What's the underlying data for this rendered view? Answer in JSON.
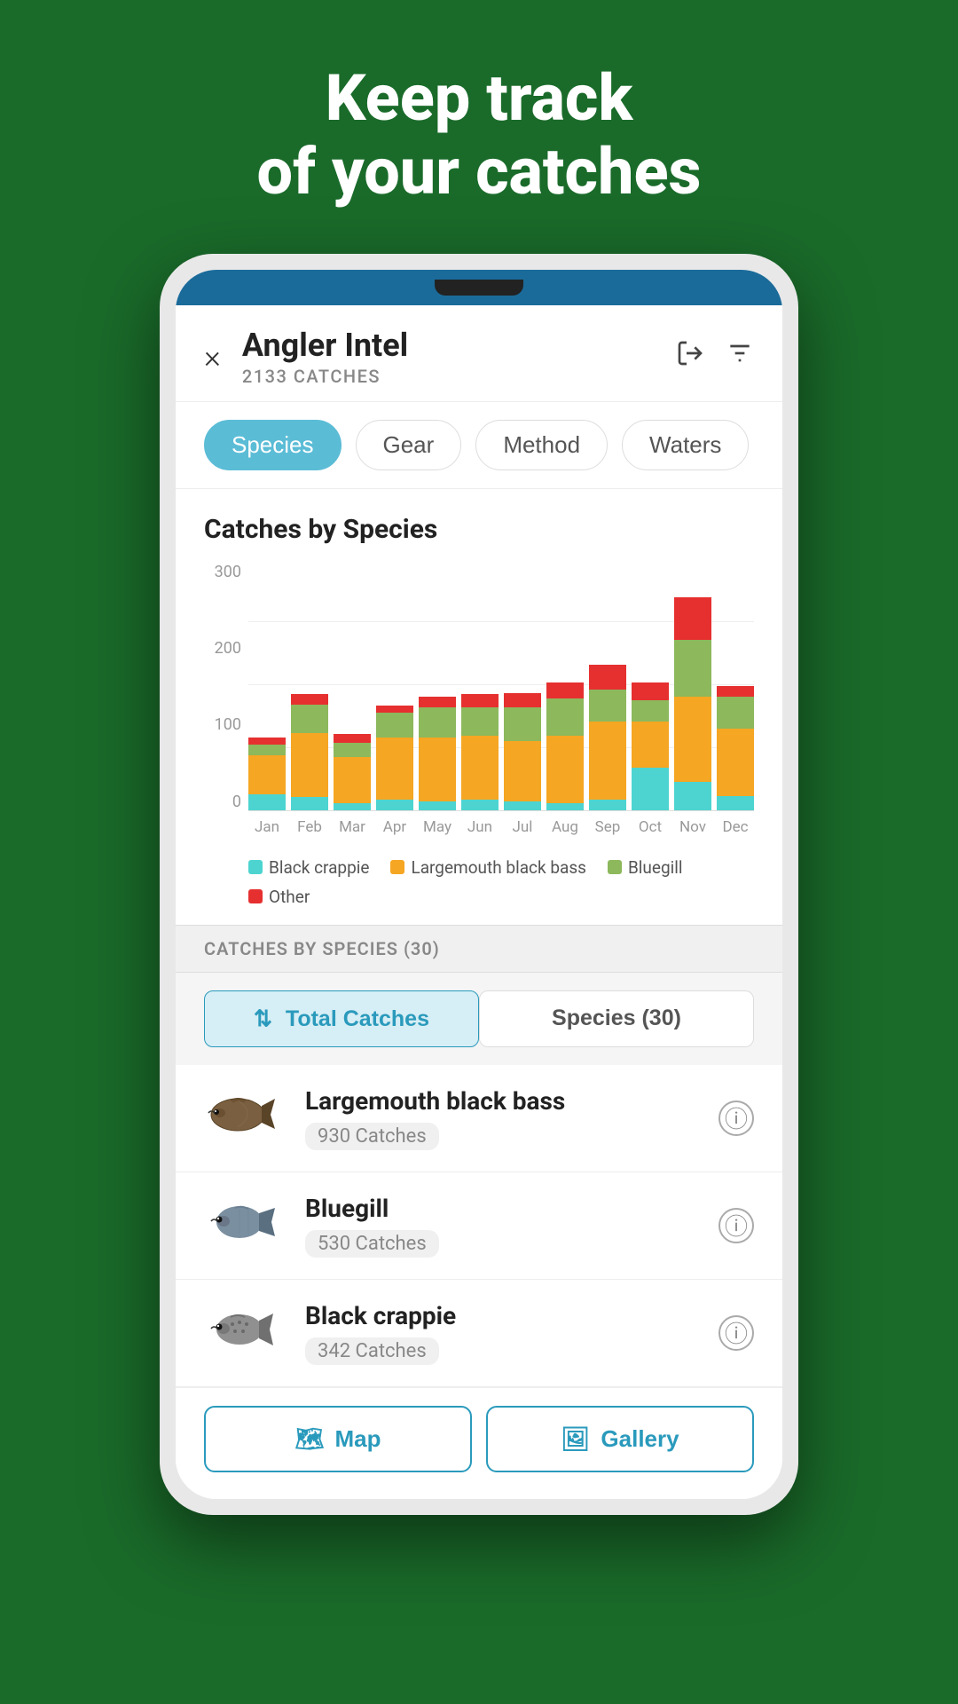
{
  "hero": {
    "line1": "Keep track",
    "line2": "of your catches"
  },
  "header": {
    "title": "Angler Intel",
    "subtitle": "2133 CATCHES",
    "close_label": "×"
  },
  "tabs": [
    {
      "label": "Species",
      "active": true
    },
    {
      "label": "Gear",
      "active": false
    },
    {
      "label": "Method",
      "active": false
    },
    {
      "label": "Waters",
      "active": false
    }
  ],
  "chart": {
    "title": "Catches by Species",
    "y_labels": [
      "300",
      "200",
      "100",
      "0"
    ],
    "x_labels": [
      "Jan",
      "Feb",
      "Mar",
      "Apr",
      "May",
      "Jun",
      "Jul",
      "Aug",
      "Sep",
      "Oct",
      "Nov",
      "Dec"
    ],
    "legend": [
      {
        "label": "Black crappie",
        "color": "#4dd4d0"
      },
      {
        "label": "Largemouth black bass",
        "color": "#f5a623"
      },
      {
        "label": "Bluegill",
        "color": "#8db85c"
      },
      {
        "label": "Other",
        "color": "#e63030"
      }
    ],
    "bars": [
      {
        "crappie": 22,
        "bass": 55,
        "bluegill": 15,
        "other": 10
      },
      {
        "crappie": 18,
        "bass": 90,
        "bluegill": 40,
        "other": 15
      },
      {
        "crappie": 10,
        "bass": 65,
        "bluegill": 20,
        "other": 12
      },
      {
        "crappie": 14,
        "bass": 88,
        "bluegill": 35,
        "other": 10
      },
      {
        "crappie": 12,
        "bass": 90,
        "bluegill": 42,
        "other": 15
      },
      {
        "crappie": 15,
        "bass": 90,
        "bluegill": 40,
        "other": 18
      },
      {
        "crappie": 12,
        "bass": 85,
        "bluegill": 48,
        "other": 20
      },
      {
        "crappie": 10,
        "bass": 95,
        "bluegill": 52,
        "other": 22
      },
      {
        "crappie": 14,
        "bass": 110,
        "bluegill": 45,
        "other": 35
      },
      {
        "crappie": 60,
        "bass": 65,
        "bluegill": 30,
        "other": 25
      },
      {
        "crappie": 40,
        "bass": 120,
        "bluegill": 80,
        "other": 60
      },
      {
        "crappie": 20,
        "bass": 95,
        "bluegill": 45,
        "other": 15
      }
    ]
  },
  "list_header": "CATCHES BY SPECIES (30)",
  "sort_tabs": [
    {
      "label": "Total Catches",
      "active": true,
      "icon": "⇅"
    },
    {
      "label": "Species (30)",
      "active": false
    }
  ],
  "fish": [
    {
      "name": "Largemouth black bass",
      "catches": "930 Catches",
      "type": "largemouth"
    },
    {
      "name": "Bluegill",
      "catches": "530 Catches",
      "type": "bluegill"
    },
    {
      "name": "Black crappie",
      "catches": "342 Catches",
      "type": "crappie"
    }
  ],
  "bottom_buttons": [
    {
      "label": "Map",
      "icon": "🗺"
    },
    {
      "label": "Gallery",
      "icon": "🖼"
    }
  ]
}
